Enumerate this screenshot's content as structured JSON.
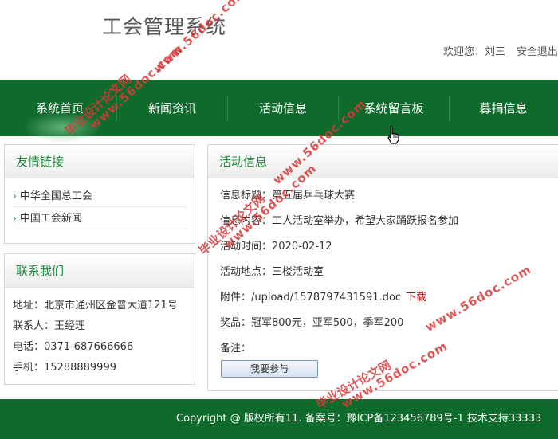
{
  "header": {
    "site_title": "工会管理系统",
    "welcome": "欢迎您：刘三",
    "logout": "安全退出"
  },
  "nav": [
    {
      "label": "系统首页"
    },
    {
      "label": "新闻资讯"
    },
    {
      "label": "活动信息"
    },
    {
      "label": "系统留言板"
    },
    {
      "label": "募捐信息"
    }
  ],
  "friend_links": {
    "title": "友情链接",
    "items": [
      "中华全国总工会",
      "中国工会新闻"
    ]
  },
  "contact": {
    "title": "联系我们",
    "address": "地址：北京市通州区金普大道121号",
    "person": "联系人：王经理",
    "phone": "电话：0371-687666666",
    "mobile": "手机：15288889999"
  },
  "activity": {
    "title": "活动信息",
    "info_title": "信息标题：第五届乒乓球大赛",
    "info_content": "信息内容：工人活动室举办，希望大家踊跃报名参加",
    "time": "活动时间：2020-02-12",
    "location": "活动地点：三楼活动室",
    "attachment": "附件：/upload/1578797431591.doc",
    "download": "下载",
    "prize": "奖品：冠军800元，亚军500，季军200",
    "remark": "备注：",
    "join_button": "我要参与"
  },
  "footer": {
    "copyright": "Copyright @ 版权所有11. 备案号：豫ICP备123456789号-1   技术支持33333"
  },
  "watermark": {
    "cn": "毕业设计论文网",
    "en": "www.56doc.com"
  },
  "colors": {
    "brand_green": "#0f6b2c",
    "heading_green": "#1d8a3c",
    "download_red": "#d40000"
  }
}
